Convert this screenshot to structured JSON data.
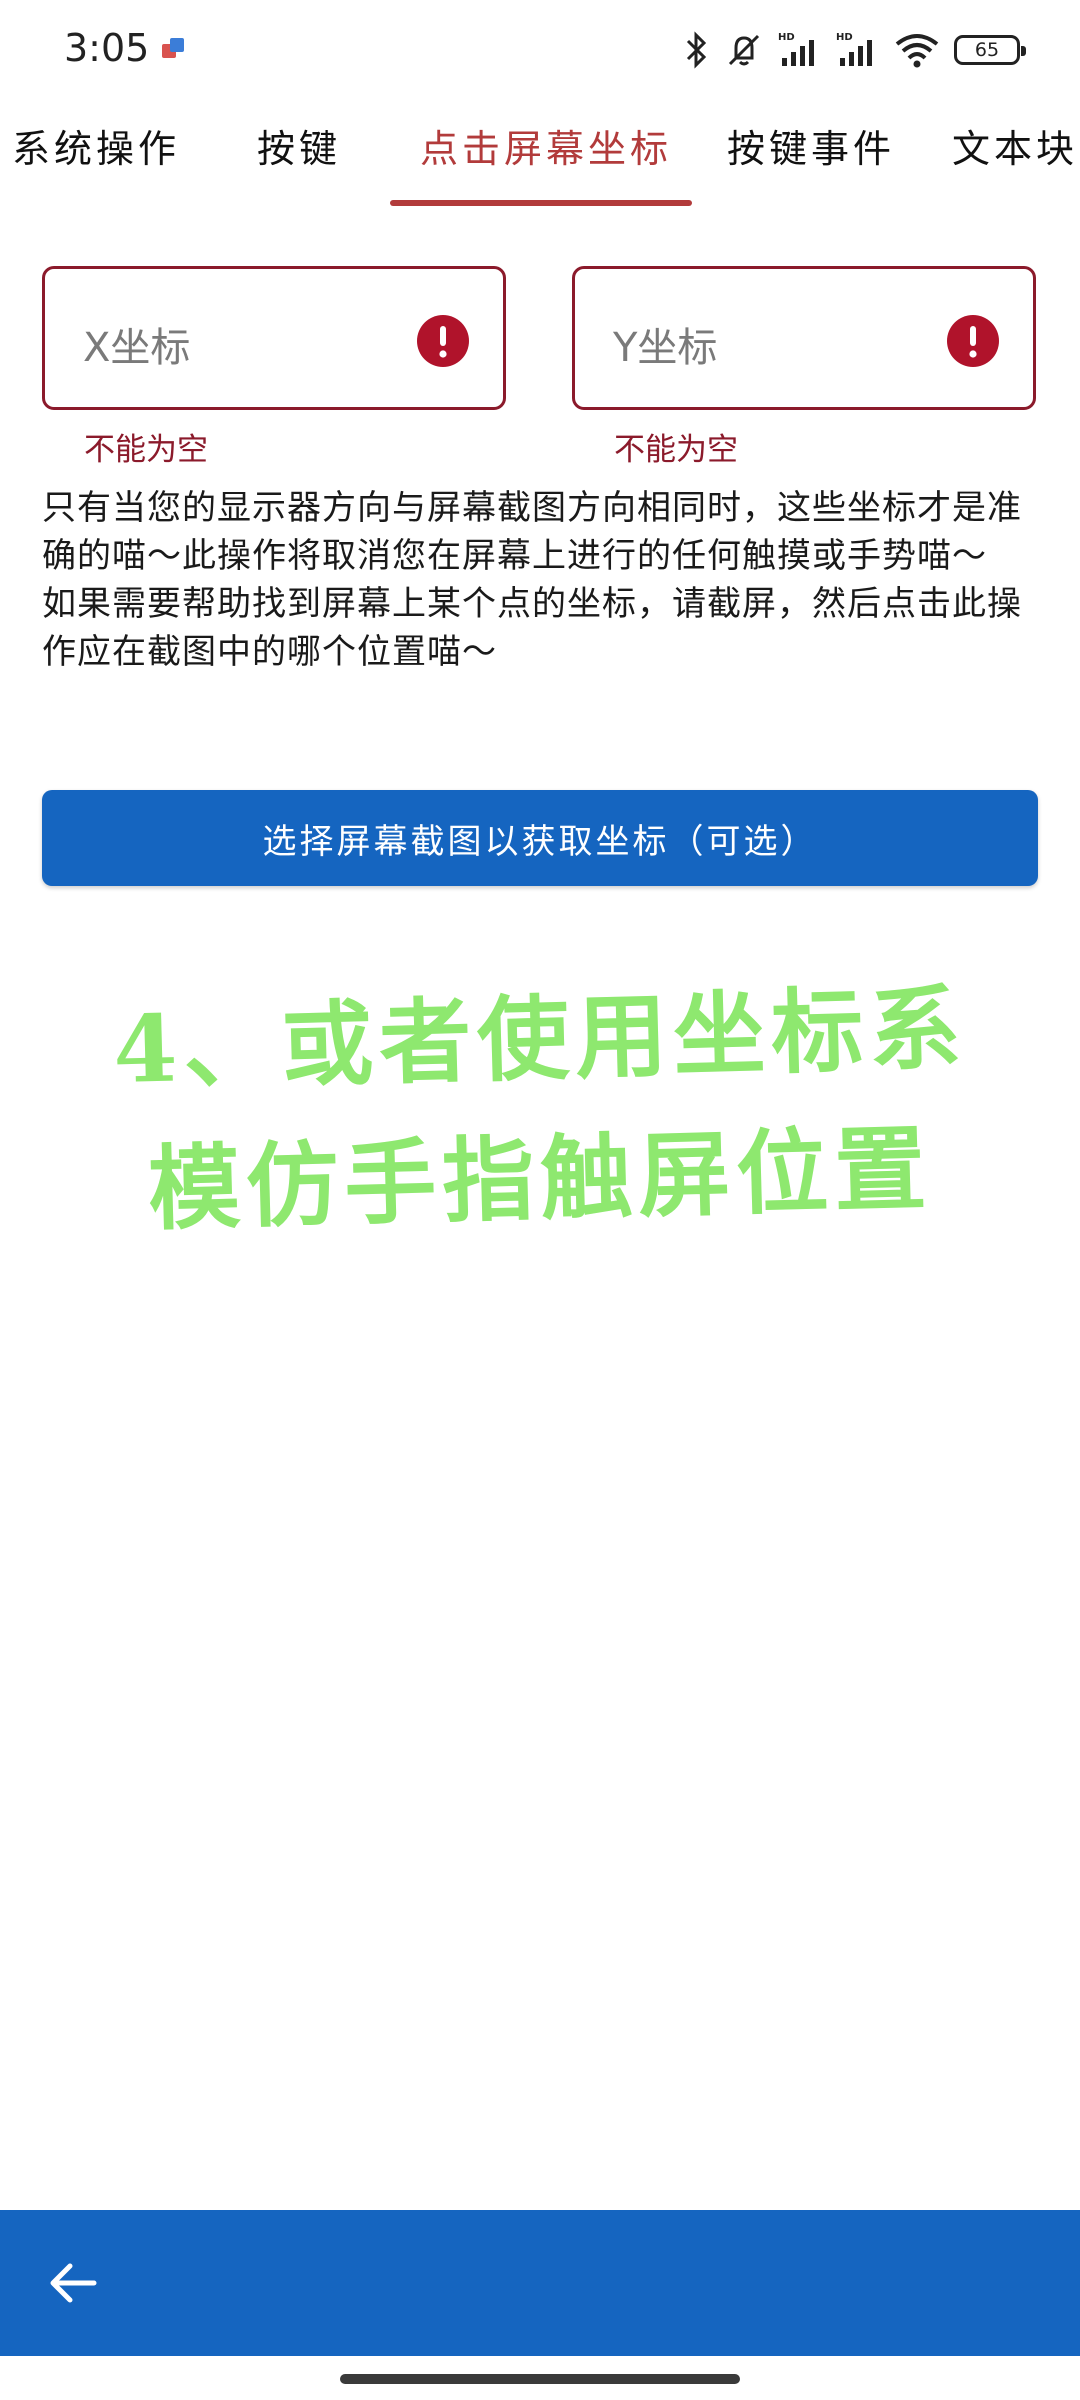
{
  "status_bar": {
    "time": "3:05",
    "battery": "65",
    "icons": [
      "notification-app-icon",
      "bluetooth-icon",
      "mute-icon",
      "signal-hd-1-icon",
      "signal-hd-2-icon",
      "wifi-icon",
      "battery-icon"
    ]
  },
  "tabs": [
    {
      "label": "系统操作",
      "active": false
    },
    {
      "label": "按键",
      "active": false
    },
    {
      "label": "点击屏幕坐标",
      "active": true
    },
    {
      "label": "按键事件",
      "active": false
    },
    {
      "label": "文本块",
      "active": false
    }
  ],
  "form": {
    "x_field": {
      "placeholder": "X坐标",
      "value": "",
      "error": "不能为空"
    },
    "y_field": {
      "placeholder": "Y坐标",
      "value": "",
      "error": "不能为空"
    }
  },
  "description": "只有当您的显示器方向与屏幕截图方向相同时，这些坐标才是准确的喵～此操作将取消您在屏幕上进行的任何触摸或手势喵～\n如果需要帮助找到屏幕上某个点的坐标，请截屏，然后点击此操作应在截图中的哪个位置喵～",
  "select_button": "选择屏幕截图以获取坐标（可选）",
  "overlay": {
    "line1": "4、或者使用坐标系",
    "line2": "模仿手指触屏位置"
  },
  "colors": {
    "accent_tab": "#b23b3b",
    "error": "#8b1a2b",
    "primary": "#1565c0",
    "overlay_text": "#8ee86f"
  }
}
